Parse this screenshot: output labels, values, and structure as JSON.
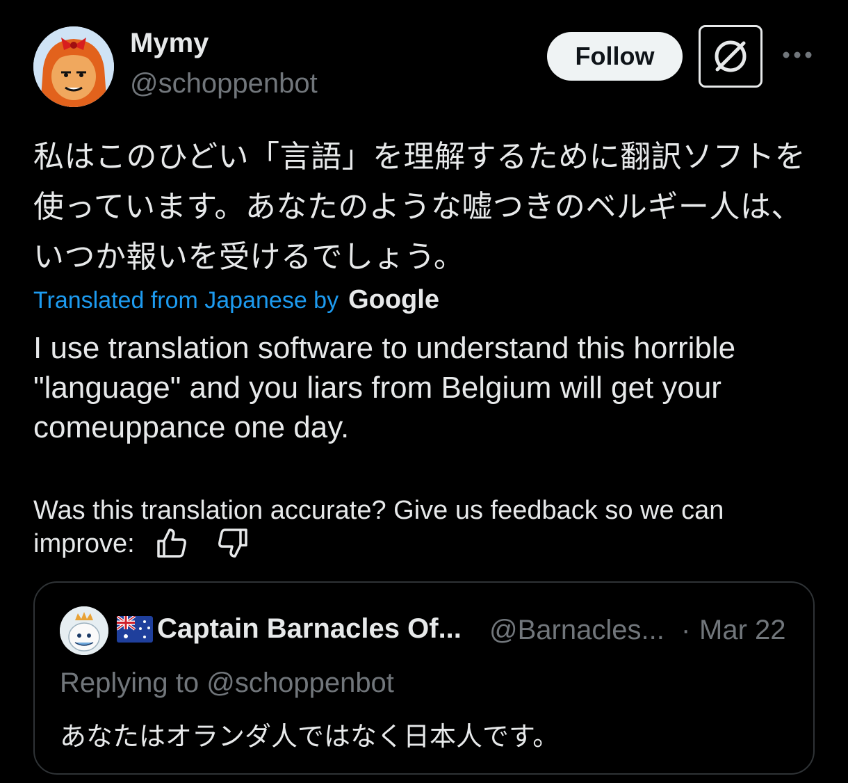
{
  "post": {
    "author": {
      "display_name": "Mymy",
      "handle": "@schoppenbot",
      "avatar": "cartoon-avatar"
    },
    "follow_label": "Follow",
    "grok_icon": "grok-icon",
    "more_icon": "more-horizontal-icon",
    "original_text": "私はこのひどい「言語」を理解するために翻訳ソフトを使っています。あなたのような嘘つきのベルギー人は、いつか報いを受けるでしょう。",
    "translated_from": "Translated from Japanese by",
    "translator_name": "Google",
    "translation": "I use translation software to understand this horrible \"language\" and you liars from Belgium will get your comeuppance one day.",
    "feedback_prompt": "Was this translation accurate? Give us feedback so we can improve:",
    "feedback_icons": [
      "thumbs-up-icon",
      "thumbs-down-icon"
    ]
  },
  "quoted_post": {
    "avatar": "mascot-avatar",
    "flag": "australia-flag",
    "display_name": "Captain Barnacles Of...",
    "handle": "@Barnacles...",
    "separator": "·",
    "date": "Mar 22",
    "replying_to": "Replying to @schoppenbot",
    "text": "あなたはオランダ人ではなく日本人です。"
  },
  "colors": {
    "background": "#000000",
    "text": "#e7e9ea",
    "secondary_text": "#71767b",
    "link": "#1d9bf0",
    "border": "#2f3336"
  }
}
